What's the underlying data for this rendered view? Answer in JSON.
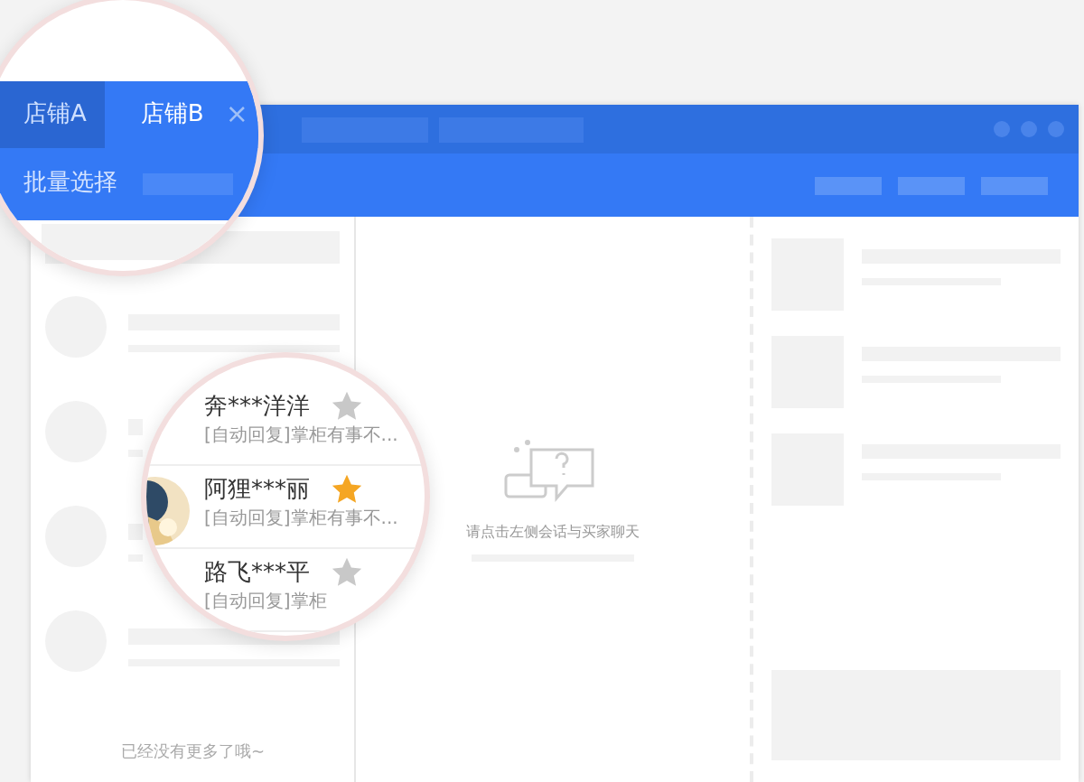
{
  "tabs": [
    {
      "label": "店铺A",
      "selected": false
    },
    {
      "label": "店铺B",
      "selected": true,
      "close": "×"
    }
  ],
  "toolbar": {
    "batch_select": "批量选择"
  },
  "conversations": [
    {
      "name": "奔***洋洋",
      "preview": "[自动回复]掌柜有事不...",
      "starred": false,
      "avatar": false
    },
    {
      "name": "阿狸***丽",
      "preview": "[自动回复]掌柜有事不...",
      "starred": true,
      "avatar": true
    },
    {
      "name": "路飞***平",
      "preview": "[自动回复]掌柜",
      "starred": false,
      "avatar": false
    }
  ],
  "list_footer": "已经没有更多了哦~",
  "empty_chat": {
    "message": "请点击左侧会话与买家聊天"
  }
}
